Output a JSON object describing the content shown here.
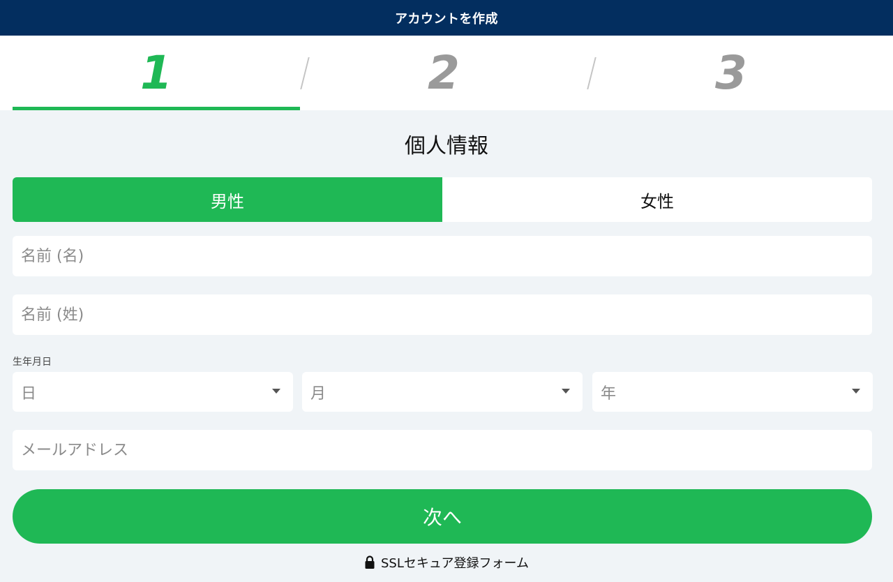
{
  "header": {
    "title": "アカウントを作成"
  },
  "stepper": {
    "steps": [
      {
        "label": "1",
        "state": "active"
      },
      {
        "label": "2",
        "state": "inactive"
      },
      {
        "label": "3",
        "state": "inactive"
      }
    ]
  },
  "form": {
    "section_title": "個人情報",
    "gender": {
      "options": [
        "男性",
        "女性"
      ],
      "selected": "男性"
    },
    "first_name": {
      "placeholder": "名前 (名)",
      "value": ""
    },
    "last_name": {
      "placeholder": "名前 (姓)",
      "value": ""
    },
    "dob": {
      "label": "生年月日",
      "day": {
        "selected": "日"
      },
      "month": {
        "selected": "月"
      },
      "year": {
        "selected": "年"
      }
    },
    "email": {
      "placeholder": "メールアドレス",
      "value": ""
    },
    "next_button": "次へ",
    "ssl_note": "SSLセキュア登録フォーム"
  },
  "colors": {
    "header_bg": "#032e5f",
    "accent": "#1fb855",
    "page_bg": "#f0f4f7",
    "inactive_step": "#9a9a9a"
  },
  "icons": {
    "lock": "lock-icon",
    "dropdown": "chevron-down-icon"
  }
}
